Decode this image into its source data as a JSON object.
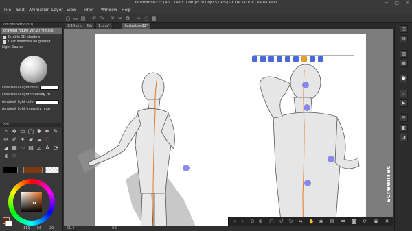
{
  "window": {
    "title": "Illustration12* (A6 1748 x 1240px 300dpi 51.4%) - CLIP STUDIO PAINT PRO",
    "min": "─",
    "max": "□",
    "close": "✕"
  },
  "menu": [
    "File",
    "Edit",
    "Animation",
    "Layer",
    "View",
    "Filter",
    "Window",
    "Help"
  ],
  "tabs": [
    {
      "label": "1/14.png"
    },
    {
      "label": "Tab"
    },
    {
      "label": "1.png*"
    },
    {
      "label": "Illustration12*"
    }
  ],
  "left": {
    "panel_title": "Tool property (3D)",
    "sub_tool": "drawing figure Ver.2 (Female)",
    "enable_label": "Enable 3D shadow",
    "cast_label": "Cast shadows on ground",
    "light_source": "Light Source",
    "dir_light_color": "Directional light color",
    "dir_light_intensity": "Directional light intensity",
    "dir_light_value": "1.20",
    "ambient_color": "Ambient light color",
    "ambient_intensity": "Ambient light intensity",
    "ambient_value": "0.40",
    "tool_panel_title": "Tool",
    "color_values": [
      "111",
      "56",
      "20"
    ]
  },
  "status": {
    "zoom": "51.4",
    "angle": "0.0"
  },
  "watermark": "screenrec",
  "colors": {
    "accent_blue": "#7070ee",
    "orange_line": "#e07a2a",
    "fg_color": "#6a2a10",
    "bg_color": "#ffffff",
    "brown_swatch": "#7a3a14"
  },
  "icons": {
    "window_controls": [
      "minimize-icon",
      "maximize-icon",
      "close-icon"
    ]
  }
}
